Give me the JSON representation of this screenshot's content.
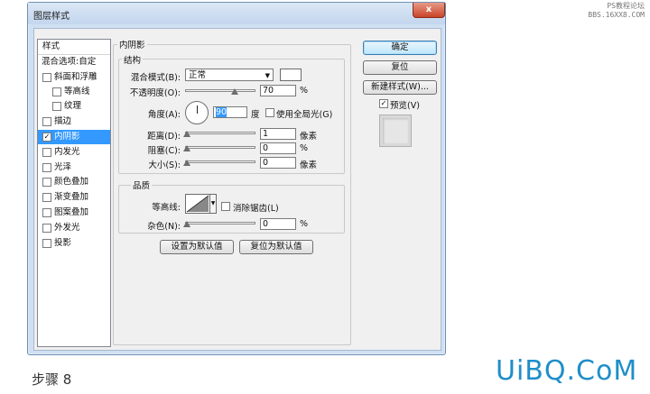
{
  "watermark": {
    "line1": "PS教程论坛",
    "line2": "BBS.16XX8.COM"
  },
  "window": {
    "title": "图层样式",
    "close_label": "x"
  },
  "style_list": {
    "header": "样式",
    "blend_options": "混合选项:自定",
    "items": [
      {
        "label": "斜面和浮雕",
        "checked": false,
        "checkmark": ""
      },
      {
        "label": "等高线",
        "checked": false,
        "checkmark": ""
      },
      {
        "label": "纹理",
        "checked": false,
        "checkmark": ""
      },
      {
        "label": "描边",
        "checked": false,
        "checkmark": ""
      },
      {
        "label": "内阴影",
        "checked": true,
        "checkmark": "✓"
      },
      {
        "label": "内发光",
        "checked": false,
        "checkmark": ""
      },
      {
        "label": "光泽",
        "checked": false,
        "checkmark": ""
      },
      {
        "label": "颜色叠加",
        "checked": false,
        "checkmark": ""
      },
      {
        "label": "渐变叠加",
        "checked": false,
        "checkmark": ""
      },
      {
        "label": "图案叠加",
        "checked": false,
        "checkmark": ""
      },
      {
        "label": "外发光",
        "checked": false,
        "checkmark": ""
      },
      {
        "label": "投影",
        "checked": false,
        "checkmark": ""
      }
    ]
  },
  "inner_shadow": {
    "section_title": "内阴影",
    "structure": {
      "title": "结构",
      "blend_mode_label": "混合模式(B):",
      "blend_mode_value": "正常",
      "opacity_label": "不透明度(O):",
      "opacity_value": "70",
      "opacity_unit": "%",
      "opacity_fraction": 0.7,
      "angle_label": "角度(A):",
      "angle_value": "90",
      "angle_unit": "度",
      "global_light_label": "使用全局光(G)",
      "global_light_checked": false,
      "distance_label": "距离(D):",
      "distance_value": "1",
      "distance_unit": "像素",
      "choke_label": "阻塞(C):",
      "choke_value": "0",
      "choke_unit": "%",
      "size_label": "大小(S):",
      "size_value": "0",
      "size_unit": "像素"
    },
    "quality": {
      "title": "品质",
      "contour_label": "等高线:",
      "anti_alias_label": "消除锯齿(L)",
      "anti_alias_checked": false,
      "noise_label": "杂色(N):",
      "noise_value": "0",
      "noise_unit": "%"
    },
    "reset_default_btn": "设置为默认值",
    "restore_default_btn": "复位为默认值"
  },
  "right_panel": {
    "ok": "确定",
    "reset": "复位",
    "new_style": "新建样式(W)...",
    "preview_label": "预览(V)",
    "preview_checked": true,
    "preview_checkmark": "✓"
  },
  "caption": "步骤 8",
  "brand": "UiBQ.CoM",
  "colors": {
    "selection": "#3399ff",
    "brand": "#1f8ec9"
  }
}
